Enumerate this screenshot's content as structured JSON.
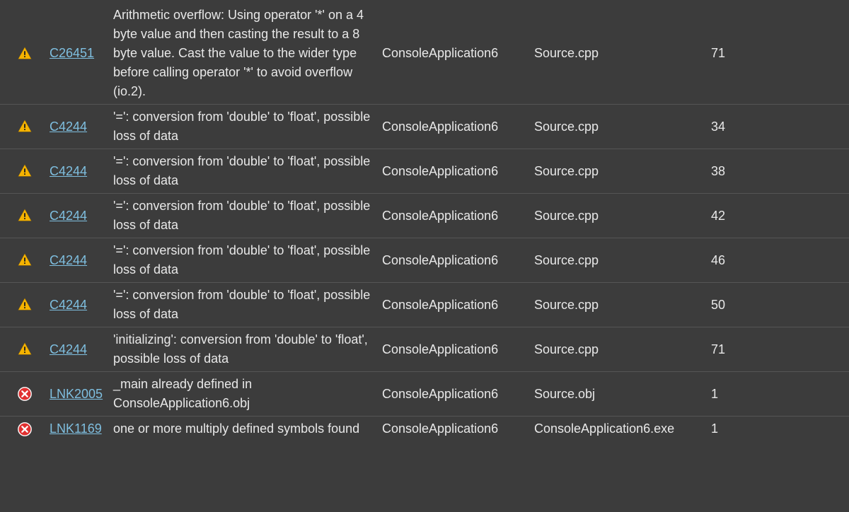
{
  "rows": [
    {
      "severity": "warning",
      "code": "C26451",
      "description": "Arithmetic overflow: Using operator '*' on a 4 byte value and then casting the result to a 8 byte value. Cast the value to the wider type before calling operator '*' to avoid overflow (io.2).",
      "project": "ConsoleApplication6",
      "file": "Source.cpp",
      "line": "71"
    },
    {
      "severity": "warning",
      "code": "C4244",
      "description": "'=': conversion from 'double' to 'float', possible loss of data",
      "project": "ConsoleApplication6",
      "file": "Source.cpp",
      "line": "34"
    },
    {
      "severity": "warning",
      "code": "C4244",
      "description": "'=': conversion from 'double' to 'float', possible loss of data",
      "project": "ConsoleApplication6",
      "file": "Source.cpp",
      "line": "38"
    },
    {
      "severity": "warning",
      "code": "C4244",
      "description": "'=': conversion from 'double' to 'float', possible loss of data",
      "project": "ConsoleApplication6",
      "file": "Source.cpp",
      "line": "42"
    },
    {
      "severity": "warning",
      "code": "C4244",
      "description": "'=': conversion from 'double' to 'float', possible loss of data",
      "project": "ConsoleApplication6",
      "file": "Source.cpp",
      "line": "46"
    },
    {
      "severity": "warning",
      "code": "C4244",
      "description": "'=': conversion from 'double' to 'float', possible loss of data",
      "project": "ConsoleApplication6",
      "file": "Source.cpp",
      "line": "50"
    },
    {
      "severity": "warning",
      "code": "C4244",
      "description": "'initializing': conversion from 'double' to 'float', possible loss of data",
      "project": "ConsoleApplication6",
      "file": "Source.cpp",
      "line": "71"
    },
    {
      "severity": "error",
      "code": "LNK2005",
      "description": "_main already defined in ConsoleApplication6.obj",
      "project": "ConsoleApplication6",
      "file": "Source.obj",
      "line": "1"
    },
    {
      "severity": "error",
      "code": "LNK1169",
      "description": "one or more multiply defined symbols found",
      "project": "ConsoleApplication6",
      "file": "ConsoleApplication6.exe",
      "line": "1"
    }
  ]
}
